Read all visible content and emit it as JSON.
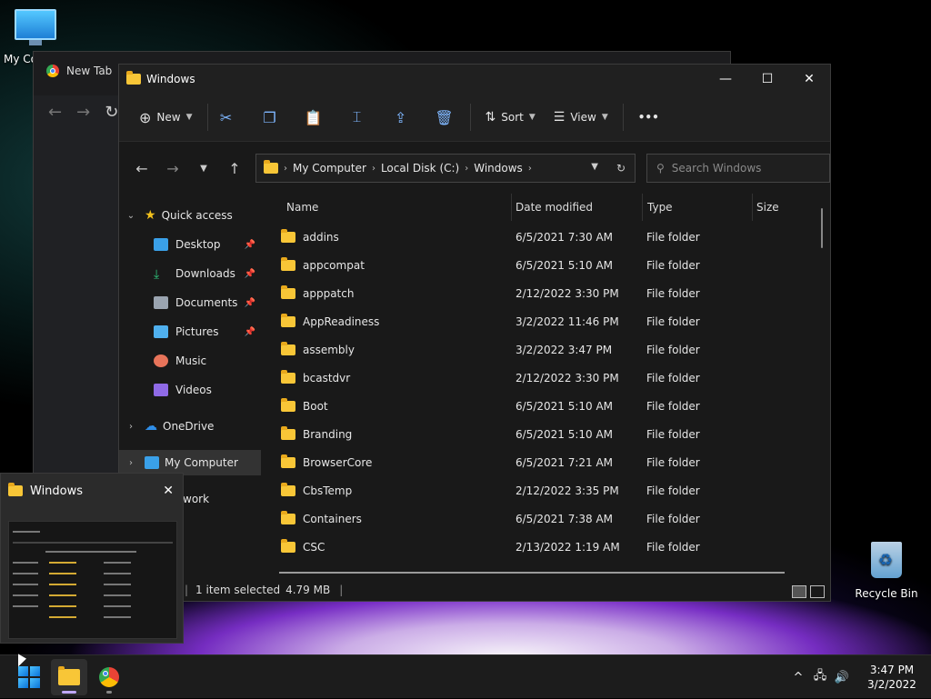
{
  "desktop": {
    "my_computer_label": "My Co",
    "recycle_bin_label": "Recycle Bin"
  },
  "background_browser": {
    "tab_title": "New Tab"
  },
  "explorer": {
    "title": "Windows",
    "toolbar": {
      "new_label": "New",
      "sort_label": "Sort",
      "view_label": "View",
      "more_label": "•••"
    },
    "address": {
      "crumbs": [
        "My Computer",
        "Local Disk (C:)",
        "Windows"
      ]
    },
    "search": {
      "placeholder": "Search Windows"
    },
    "sidebar": {
      "items": [
        {
          "label": "Quick access",
          "icon": "star-icon",
          "color": "#f2c11c"
        },
        {
          "label": "Desktop",
          "icon": "desktop-icon",
          "color": "#3aa0e8"
        },
        {
          "label": "Downloads",
          "icon": "download-icon",
          "color": "#2fc27a"
        },
        {
          "label": "Documents",
          "icon": "document-icon",
          "color": "#9aa4b0"
        },
        {
          "label": "Pictures",
          "icon": "pictures-icon",
          "color": "#4fb0ee"
        },
        {
          "label": "Music",
          "icon": "music-icon",
          "color": "#e8745a"
        },
        {
          "label": "Videos",
          "icon": "videos-icon",
          "color": "#8f6ae6"
        },
        {
          "label": "OneDrive",
          "icon": "onedrive-icon",
          "color": "#2f8ee8"
        },
        {
          "label": "My Computer",
          "icon": "computer-icon",
          "color": "#3aa0e8"
        },
        {
          "label": "work",
          "icon": "network-icon",
          "color": "#3aa0e8"
        }
      ]
    },
    "columns": [
      "Name",
      "Date modified",
      "Type",
      "Size"
    ],
    "files": [
      {
        "name": "addins",
        "date": "6/5/2021 7:30 AM",
        "type": "File folder"
      },
      {
        "name": "appcompat",
        "date": "6/5/2021 5:10 AM",
        "type": "File folder"
      },
      {
        "name": "apppatch",
        "date": "2/12/2022 3:30 PM",
        "type": "File folder"
      },
      {
        "name": "AppReadiness",
        "date": "3/2/2022 11:46 PM",
        "type": "File folder"
      },
      {
        "name": "assembly",
        "date": "3/2/2022 3:47 PM",
        "type": "File folder"
      },
      {
        "name": "bcastdvr",
        "date": "2/12/2022 3:30 PM",
        "type": "File folder"
      },
      {
        "name": "Boot",
        "date": "6/5/2021 5:10 AM",
        "type": "File folder"
      },
      {
        "name": "Branding",
        "date": "6/5/2021 5:10 AM",
        "type": "File folder"
      },
      {
        "name": "BrowserCore",
        "date": "6/5/2021 7:21 AM",
        "type": "File folder"
      },
      {
        "name": "CbsTemp",
        "date": "2/12/2022 3:35 PM",
        "type": "File folder"
      },
      {
        "name": "Containers",
        "date": "6/5/2021 7:38 AM",
        "type": "File folder"
      },
      {
        "name": "CSC",
        "date": "2/13/2022 1:19 AM",
        "type": "File folder"
      }
    ],
    "status": {
      "selection": "1 item selected",
      "size": "4.79 MB"
    }
  },
  "thumbnail": {
    "title": "Windows"
  },
  "taskbar": {
    "time": "3:47 PM",
    "date": "3/2/2022"
  },
  "colors": {
    "folder": "#f8c637",
    "accent": "#4cc2ff"
  }
}
